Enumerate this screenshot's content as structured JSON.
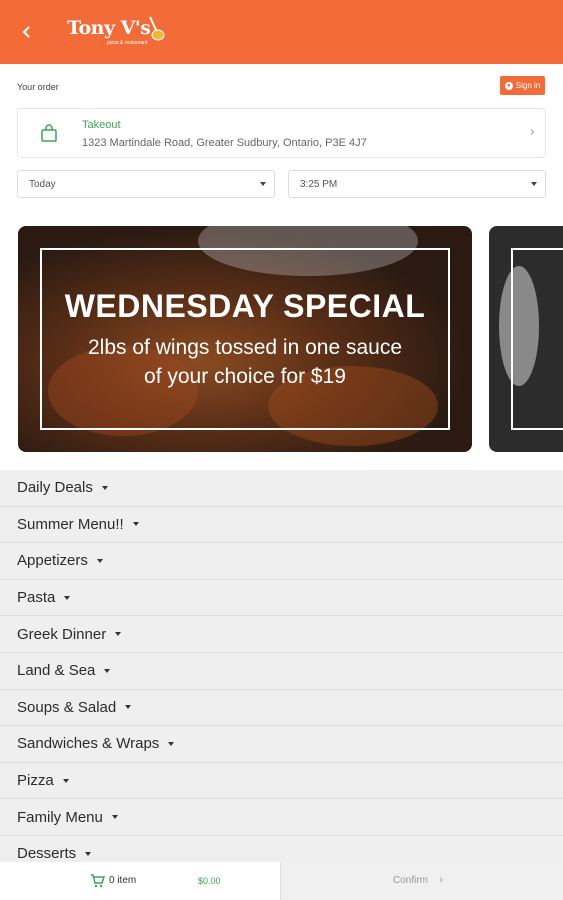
{
  "header": {
    "back_icon": "chevron-left-icon",
    "logo_text": "Tony V's",
    "logo_subtext": "pizza & restaurant",
    "brand_color": "#f26b38"
  },
  "order": {
    "label": "Your order",
    "signin_label": "Sign in",
    "takeout": {
      "title": "Takeout",
      "address": "1323 Martindale Road, Greater Sudbury, Ontario, P3E 4J7"
    },
    "day_select": "Today",
    "time_select": "3:25 PM"
  },
  "banner": {
    "title": "WEDNESDAY SPECIAL",
    "line1": "2lbs of wings tossed in one sauce",
    "line2": "of your choice for $19"
  },
  "menu": {
    "items": [
      "Daily Deals",
      "Summer Menu!!",
      "Appetizers",
      "Pasta",
      "Greek Dinner",
      "Land & Sea",
      "Soups & Salad",
      "Sandwiches & Wraps",
      "Pizza",
      "Family Menu",
      "Desserts"
    ]
  },
  "cart": {
    "count_label": "0 item",
    "total": "$0.00",
    "confirm_label": "Confirm",
    "accent_green": "#3aa655"
  }
}
